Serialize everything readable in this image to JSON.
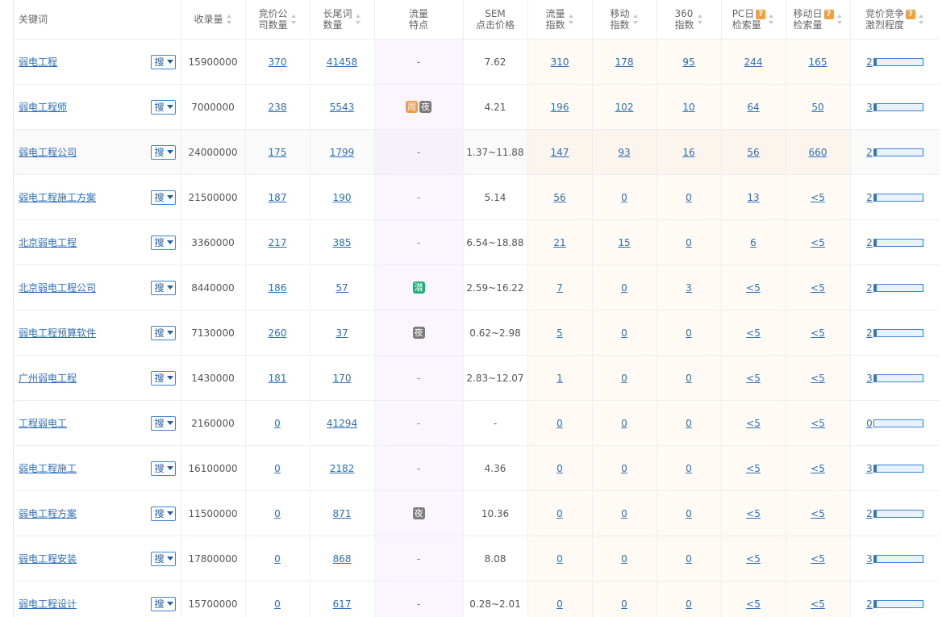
{
  "header": {
    "keyword": "关键词",
    "volume": "收录量",
    "bid_companies": [
      "竞价公",
      "司数量"
    ],
    "longtail": [
      "长尾词",
      "数量"
    ],
    "traffic_feat": [
      "流量",
      "特点"
    ],
    "sem": [
      "SEM",
      "点击价格"
    ],
    "traffic_idx": [
      "流量",
      "指数"
    ],
    "mobile_idx": [
      "移动",
      "指数"
    ],
    "idx360": [
      "360",
      "指数"
    ],
    "pc_search": [
      "PC日",
      "检索量"
    ],
    "mobile_search": [
      "移动日",
      "检索量"
    ],
    "competition": [
      "竞价竞争",
      "激烈程度"
    ],
    "help_mark": "?"
  },
  "search_btn_label": "搜",
  "colors": {
    "link": "#2b6fc0",
    "badge_week": "#f39c3f",
    "badge_night": "#7b7b7b",
    "badge_potential": "#22b07a",
    "bar": "#2f73c7"
  },
  "rows": [
    {
      "keyword": "弱电工程",
      "volume": "15900000",
      "bid": "370",
      "longtail": "41458",
      "badges": [],
      "feat_text": "-",
      "sem": "7.62",
      "traffic": "310",
      "mobile": "178",
      "i360": "95",
      "pc": "244",
      "mob": "165",
      "comp": "2",
      "comp_level": 0.05
    },
    {
      "keyword": "弱电工程师",
      "volume": "7000000",
      "bid": "238",
      "longtail": "5543",
      "badges": [
        {
          "t": "周",
          "c": "orange"
        },
        {
          "t": "夜",
          "c": "gray"
        }
      ],
      "feat_text": "",
      "sem": "4.21",
      "traffic": "196",
      "mobile": "102",
      "i360": "10",
      "pc": "64",
      "mob": "50",
      "comp": "3",
      "comp_level": 0.05
    },
    {
      "keyword": "弱电工程公司",
      "volume": "24000000",
      "bid": "175",
      "longtail": "1799",
      "badges": [],
      "feat_text": "-",
      "sem": "1.37~11.88",
      "traffic": "147",
      "mobile": "93",
      "i360": "16",
      "pc": "56",
      "mob": "660",
      "comp": "2",
      "comp_level": 0.05
    },
    {
      "keyword": "弱电工程施工方案",
      "volume": "21500000",
      "bid": "187",
      "longtail": "190",
      "badges": [],
      "feat_text": "-",
      "sem": "5.14",
      "traffic": "56",
      "mobile": "0",
      "i360": "0",
      "pc": "13",
      "mob": "<5",
      "comp": "2",
      "comp_level": 0.05
    },
    {
      "keyword": "北京弱电工程",
      "volume": "3360000",
      "bid": "217",
      "longtail": "385",
      "badges": [],
      "feat_text": "-",
      "sem": "6.54~18.88",
      "traffic": "21",
      "mobile": "15",
      "i360": "0",
      "pc": "6",
      "mob": "<5",
      "comp": "2",
      "comp_level": 0.05
    },
    {
      "keyword": "北京弱电工程公司",
      "volume": "8440000",
      "bid": "186",
      "longtail": "57",
      "badges": [
        {
          "t": "潜",
          "c": "green"
        }
      ],
      "feat_text": "",
      "sem": "2.59~16.22",
      "traffic": "7",
      "mobile": "0",
      "i360": "3",
      "pc": "<5",
      "mob": "<5",
      "comp": "2",
      "comp_level": 0.05
    },
    {
      "keyword": "弱电工程预算软件",
      "volume": "7130000",
      "bid": "260",
      "longtail": "37",
      "badges": [
        {
          "t": "夜",
          "c": "gray"
        }
      ],
      "feat_text": "",
      "sem": "0.62~2.98",
      "traffic": "5",
      "mobile": "0",
      "i360": "0",
      "pc": "<5",
      "mob": "<5",
      "comp": "2",
      "comp_level": 0.05
    },
    {
      "keyword": "广州弱电工程",
      "volume": "1430000",
      "bid": "181",
      "longtail": "170",
      "badges": [],
      "feat_text": "-",
      "sem": "2.83~12.07",
      "traffic": "1",
      "mobile": "0",
      "i360": "0",
      "pc": "<5",
      "mob": "<5",
      "comp": "3",
      "comp_level": 0.05
    },
    {
      "keyword": "工程弱电工",
      "volume": "2160000",
      "bid": "0",
      "longtail": "41294",
      "badges": [],
      "feat_text": "-",
      "sem": "-",
      "traffic": "0",
      "mobile": "0",
      "i360": "0",
      "pc": "<5",
      "mob": "<5",
      "comp": "0",
      "comp_level": 0.0
    },
    {
      "keyword": "弱电工程施工",
      "volume": "16100000",
      "bid": "0",
      "longtail": "2182",
      "badges": [],
      "feat_text": "-",
      "sem": "4.36",
      "traffic": "0",
      "mobile": "0",
      "i360": "0",
      "pc": "<5",
      "mob": "<5",
      "comp": "3",
      "comp_level": 0.05
    },
    {
      "keyword": "弱电工程方案",
      "volume": "11500000",
      "bid": "0",
      "longtail": "871",
      "badges": [
        {
          "t": "夜",
          "c": "gray"
        }
      ],
      "feat_text": "",
      "sem": "10.36",
      "traffic": "0",
      "mobile": "0",
      "i360": "0",
      "pc": "<5",
      "mob": "<5",
      "comp": "2",
      "comp_level": 0.05
    },
    {
      "keyword": "弱电工程安装",
      "volume": "17800000",
      "bid": "0",
      "longtail": "868",
      "badges": [],
      "feat_text": "-",
      "sem": "8.08",
      "traffic": "0",
      "mobile": "0",
      "i360": "0",
      "pc": "<5",
      "mob": "<5",
      "comp": "3",
      "comp_level": 0.05
    },
    {
      "keyword": "弱电工程设计",
      "volume": "15700000",
      "bid": "0",
      "longtail": "617",
      "badges": [],
      "feat_text": "-",
      "sem": "0.28~2.01",
      "traffic": "0",
      "mobile": "0",
      "i360": "0",
      "pc": "<5",
      "mob": "<5",
      "comp": "2",
      "comp_level": 0.05
    }
  ]
}
